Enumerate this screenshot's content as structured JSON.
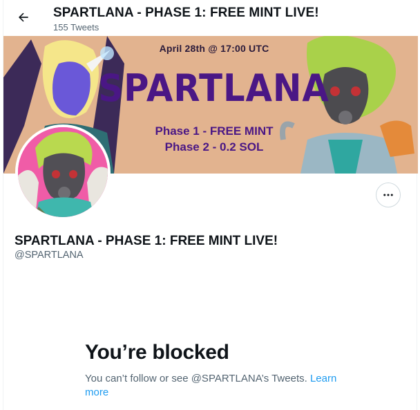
{
  "header": {
    "title": "SPARTLANA - PHASE 1: FREE MINT LIVE!",
    "tweet_count": "155 Tweets",
    "back_icon": "arrow-left-icon"
  },
  "banner": {
    "date_text": "April 28th @ 17:00 UTC",
    "brand_text": "SPARTLANA",
    "phase1_text": "Phase 1 - FREE MINT",
    "phase2_text": "Phase 2 - 0.2 SOL"
  },
  "profile": {
    "display_name": "SPARTLANA - PHASE 1: FREE MINT LIVE!",
    "handle": "@SPARTLANA",
    "more_icon": "more-horizontal-icon"
  },
  "blocked": {
    "title": "You’re blocked",
    "message": "You can’t follow or see @SPARTLANA’s Tweets.",
    "learn_more": "Learn more"
  },
  "colors": {
    "accent": "#1d9bf0",
    "text_secondary": "#536471",
    "banner_bg": "#e2b38f",
    "banner_text": "#4a1785",
    "avatar_bg": "#f05ca7"
  }
}
